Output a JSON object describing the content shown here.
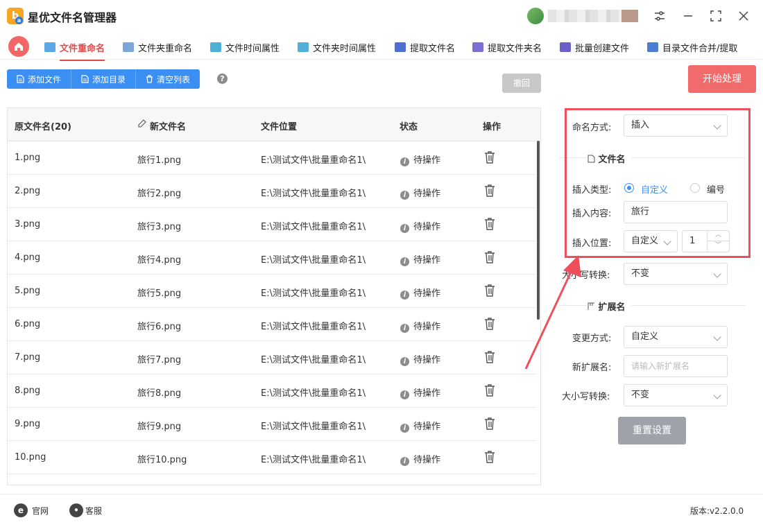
{
  "app": {
    "title": "星优文件名管理器",
    "logo_text": "b",
    "logo_sub": "a"
  },
  "tabs": [
    {
      "label": "文件重命名",
      "color": "#5ba8e6"
    },
    {
      "label": "文件夹重命名",
      "color": "#7aa6d8"
    },
    {
      "label": "文件时间属性",
      "color": "#4fb0d8"
    },
    {
      "label": "文件夹时间属性",
      "color": "#4fb0d8"
    },
    {
      "label": "提取文件名",
      "color": "#4c6fd1"
    },
    {
      "label": "提取文件夹名",
      "color": "#7b6fd1"
    },
    {
      "label": "批量创建文件",
      "color": "#6b5fc8"
    },
    {
      "label": "目录文件合并/提取",
      "color": "#4c7fd1"
    }
  ],
  "toolbar": {
    "add_file": "添加文件",
    "add_dir": "添加目录",
    "clear_list": "清空列表",
    "help": "?",
    "undo": "撤回",
    "start": "开始处理"
  },
  "table": {
    "headers": {
      "orig": "原文件名(20)",
      "new": "新文件名",
      "path": "文件位置",
      "status": "状态",
      "action": "操作"
    },
    "rows": [
      {
        "orig": "1.png",
        "new": "旅行1.png",
        "path": "E:\\测试文件\\批量重命名1\\",
        "status": "待操作"
      },
      {
        "orig": "2.png",
        "new": "旅行2.png",
        "path": "E:\\测试文件\\批量重命名1\\",
        "status": "待操作"
      },
      {
        "orig": "3.png",
        "new": "旅行3.png",
        "path": "E:\\测试文件\\批量重命名1\\",
        "status": "待操作"
      },
      {
        "orig": "4.png",
        "new": "旅行4.png",
        "path": "E:\\测试文件\\批量重命名1\\",
        "status": "待操作"
      },
      {
        "orig": "5.png",
        "new": "旅行5.png",
        "path": "E:\\测试文件\\批量重命名1\\",
        "status": "待操作"
      },
      {
        "orig": "6.png",
        "new": "旅行6.png",
        "path": "E:\\测试文件\\批量重命名1\\",
        "status": "待操作"
      },
      {
        "orig": "7.png",
        "new": "旅行7.png",
        "path": "E:\\测试文件\\批量重命名1\\",
        "status": "待操作"
      },
      {
        "orig": "8.png",
        "new": "旅行8.png",
        "path": "E:\\测试文件\\批量重命名1\\",
        "status": "待操作"
      },
      {
        "orig": "9.png",
        "new": "旅行9.png",
        "path": "E:\\测试文件\\批量重命名1\\",
        "status": "待操作"
      },
      {
        "orig": "10.png",
        "new": "旅行10.png",
        "path": "E:\\测试文件\\批量重命名1\\",
        "status": "待操作"
      }
    ]
  },
  "panel": {
    "naming_label": "命名方式:",
    "naming_value": "插入",
    "filename_section": "文件名",
    "insert_type_label": "插入类型:",
    "insert_type_custom": "自定义",
    "insert_type_number": "编号",
    "insert_content_label": "插入内容:",
    "insert_content_value": "旅行",
    "insert_pos_label": "插入位置:",
    "insert_pos_mode": "自定义",
    "insert_pos_value": "1",
    "case_label": "大小写转换:",
    "case_value": "不变",
    "ext_section": "扩展名",
    "change_mode_label": "变更方式:",
    "change_mode_value": "自定义",
    "new_ext_label": "新扩展名:",
    "new_ext_placeholder": "请输入新扩展名",
    "ext_case_label": "大小写转换:",
    "ext_case_value": "不变",
    "reset": "重置设置"
  },
  "footer": {
    "site": "官网",
    "service": "客服",
    "version": "版本:v2.2.0.0"
  },
  "colors": {
    "accent_red": "#f26b6b",
    "accent_blue": "#3b8ff3",
    "highlight": "#ef4e5b"
  }
}
